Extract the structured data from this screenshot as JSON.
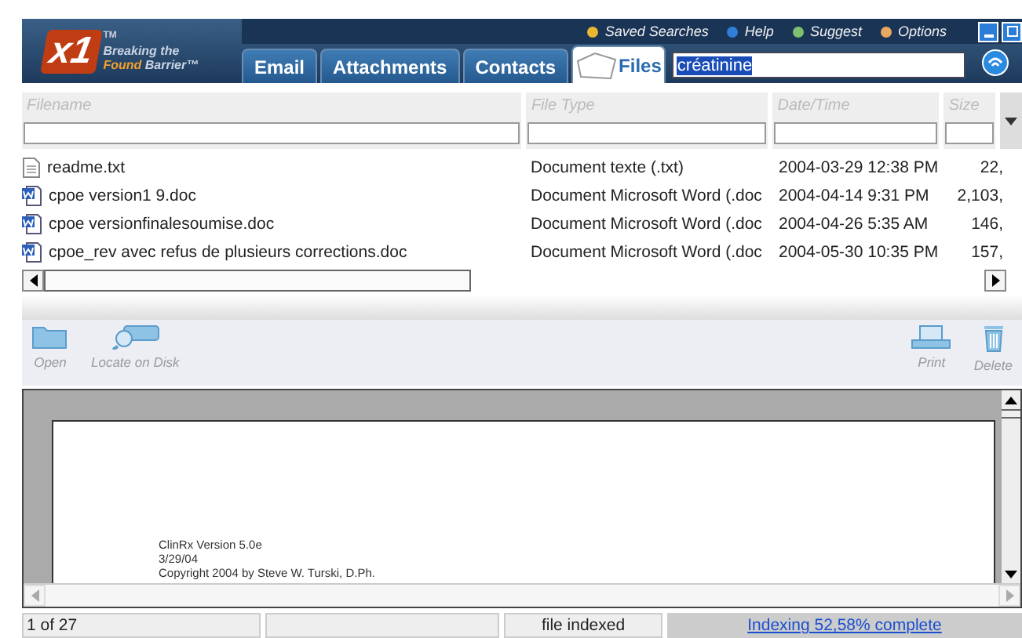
{
  "header": {
    "logo": "x1",
    "tm": "TM",
    "tagline_1": "Breaking the",
    "tagline_2a": "Found",
    "tagline_2b": "Barrier™",
    "links": [
      {
        "label": "Saved Searches",
        "color": "#e8b830"
      },
      {
        "label": "Help",
        "color": "#2f7fd8"
      },
      {
        "label": "Suggest",
        "color": "#7cc070"
      },
      {
        "label": "Options",
        "color": "#e8a860"
      }
    ],
    "tabs": [
      {
        "label": "Email",
        "selected": false
      },
      {
        "label": "Attachments",
        "selected": false
      },
      {
        "label": "Contacts",
        "selected": false
      },
      {
        "label": "Files",
        "selected": true
      }
    ],
    "search": {
      "value": "créatinine"
    }
  },
  "table": {
    "columns": [
      "Filename",
      "File Type",
      "Date/Time",
      "Size"
    ],
    "rows": [
      {
        "kind": "txt",
        "filename": "readme.txt",
        "type": "Document texte (.txt)",
        "date": "2004-03-29 12:38 PM",
        "size": "22,"
      },
      {
        "kind": "doc",
        "filename": "cpoe version1 9.doc",
        "type": "Document Microsoft Word (.doc",
        "date": "2004-04-14 9:31 PM",
        "size": "2,103,"
      },
      {
        "kind": "doc",
        "filename": "cpoe versionfinalesoumise.doc",
        "type": "Document Microsoft Word (.doc",
        "date": "2004-04-26 5:35 AM",
        "size": "146,"
      },
      {
        "kind": "doc",
        "filename": "cpoe_rev avec refus de plusieurs corrections.doc",
        "type": "Document Microsoft Word (.doc",
        "date": "2004-05-30 10:35 PM",
        "size": "157,"
      }
    ]
  },
  "toolbar": {
    "left": [
      {
        "kind": "open",
        "label": "Open"
      },
      {
        "kind": "locate",
        "label": "Locate on Disk"
      }
    ],
    "right": [
      {
        "kind": "print",
        "label": "Print"
      },
      {
        "kind": "delete",
        "label": "Delete"
      }
    ]
  },
  "preview": {
    "lines": [
      "ClinRx Version 5.0e",
      "3/29/04",
      "Copyright 2004  by Steve W. Turski, D.Ph."
    ]
  },
  "status_bar": {
    "count": "1 of 27",
    "state": "file indexed",
    "progress": "Indexing 52,58% complete"
  }
}
